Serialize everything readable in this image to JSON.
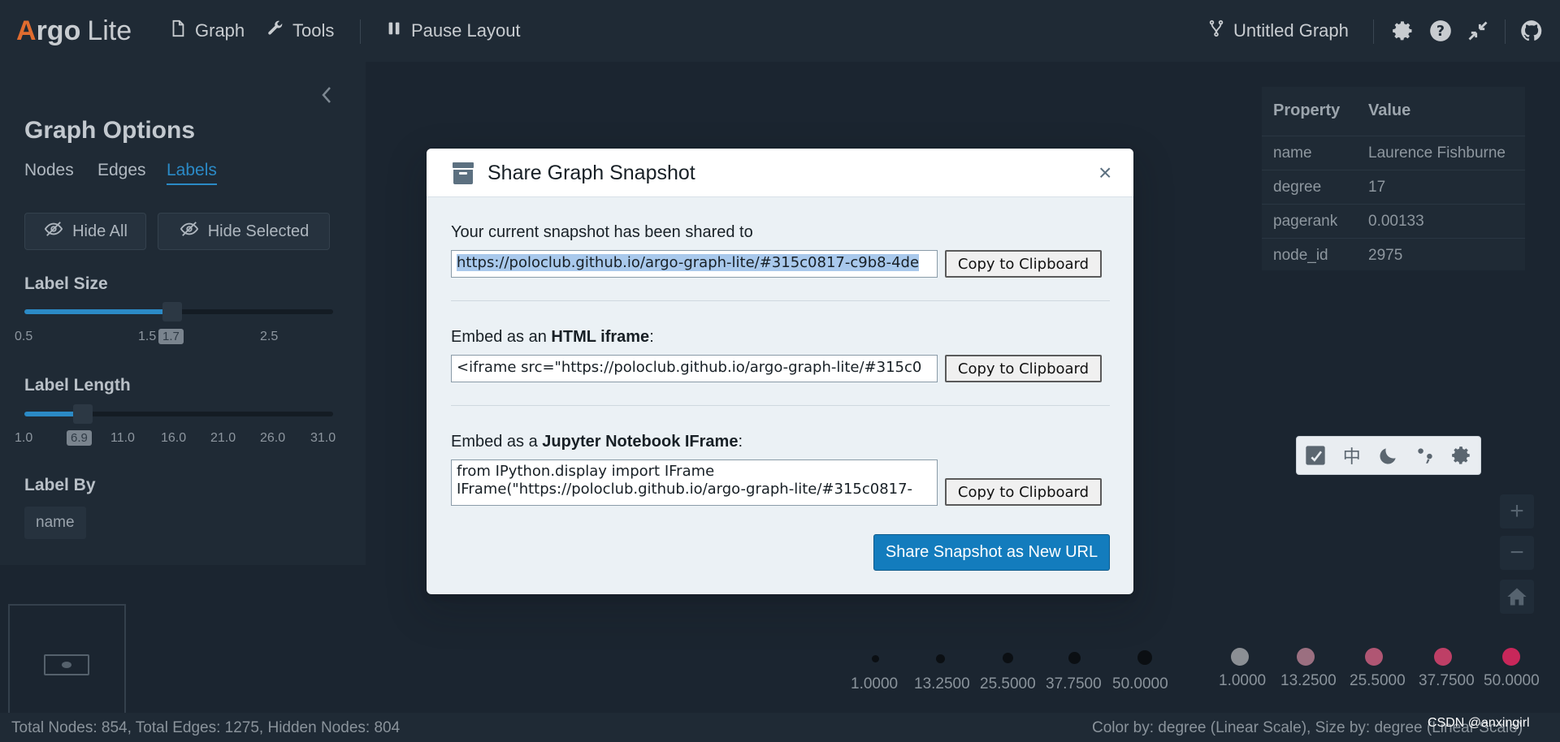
{
  "app": {
    "logo_a": "A",
    "logo_rest": "rgo",
    "logo_lite": "Lite",
    "nav_graph": "Graph",
    "nav_tools": "Tools",
    "nav_pause": "Pause Layout",
    "graph_title": "Untitled Graph"
  },
  "left_panel": {
    "title": "Graph Options",
    "tabs": [
      "Nodes",
      "Edges",
      "Labels"
    ],
    "active_tab": "Labels",
    "hide_all": "Hide All",
    "hide_selected": "Hide Selected",
    "label_size": {
      "label": "Label Size",
      "ticks": [
        "0.5",
        "1.5",
        "2.5"
      ],
      "value": "1.7"
    },
    "label_length": {
      "label": "Label Length",
      "ticks": [
        "1.0",
        "11.0",
        "16.0",
        "21.0",
        "26.0",
        "31.0"
      ],
      "value": "6.9"
    },
    "label_by": {
      "label": "Label By",
      "value": "name"
    }
  },
  "properties": {
    "header_key": "Property",
    "header_value": "Value",
    "rows": [
      {
        "key": "name",
        "value": "Laurence Fishburne"
      },
      {
        "key": "degree",
        "value": "17"
      },
      {
        "key": "pagerank",
        "value": "0.00133"
      },
      {
        "key": "node_id",
        "value": "2975"
      }
    ]
  },
  "mode_bar": {
    "buttons": [
      "sticky-note",
      "中",
      "moon",
      "dots",
      "gear"
    ]
  },
  "size_legend": [
    "1.0000",
    "13.2500",
    "25.5000",
    "37.7500",
    "50.0000"
  ],
  "color_legend": [
    "1.0000",
    "13.2500",
    "25.5000",
    "37.7500",
    "50.0000"
  ],
  "color_legend_colors": [
    "#8b8f94",
    "#9b6f80",
    "#b05673",
    "#be3f66",
    "#c8275a"
  ],
  "status": {
    "left": "Total Nodes: 854, Total Edges: 1275, Hidden Nodes: 804",
    "right": "Color by: degree (Linear Scale), Size by: degree (Linear Scale)",
    "watermark": "CSDN @anxingirl"
  },
  "modal": {
    "title": "Share Graph Snapshot",
    "close": "×",
    "shared_label": "Your current snapshot has been shared to",
    "shared_url": "https://poloclub.github.io/argo-graph-lite/#315c0817-c9b8-4de",
    "iframe_label_pre": "Embed as an ",
    "iframe_label_bold": "HTML iframe",
    "iframe_label_post": ":",
    "iframe_code": "<iframe src=\"https://poloclub.github.io/argo-graph-lite/#315c0",
    "jupyter_label_pre": "Embed as a ",
    "jupyter_label_bold": "Jupyter Notebook IFrame",
    "jupyter_label_post": ":",
    "jupyter_code": "from IPython.display import IFrame\nIFrame(\"https://poloclub.github.io/argo-graph-lite/#315c0817-",
    "copy_label": "Copy to Clipboard",
    "share_button": "Share Snapshot as New URL"
  },
  "colors": {
    "accent": "#137cbd",
    "tab_active": "#2b8ac6",
    "logo": "#e06c2f"
  }
}
